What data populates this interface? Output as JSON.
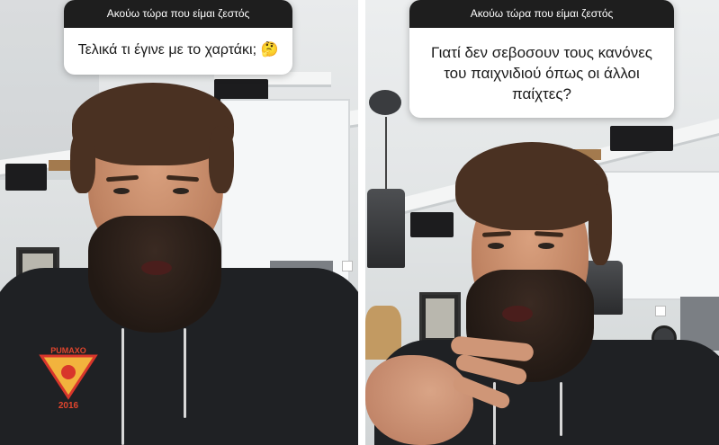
{
  "stories": [
    {
      "header": "Ακούω τώρα που είμαι ζεστός",
      "question": "Τελικά τι έγινε με το χαρτάκι;",
      "emoji": "🤔",
      "hoodie_print": [
        "PUMAXO",
        "2016"
      ]
    },
    {
      "header": "Ακούω τώρα που είμαι ζεστός",
      "question_lines": [
        "Γιατί δεν σεβοσουν τους κανόνες",
        "του παιχνιδιού όπως οι άλλοι",
        "παίχτες?"
      ]
    }
  ],
  "icons": {
    "thinking_face": "thinking-face-icon"
  }
}
